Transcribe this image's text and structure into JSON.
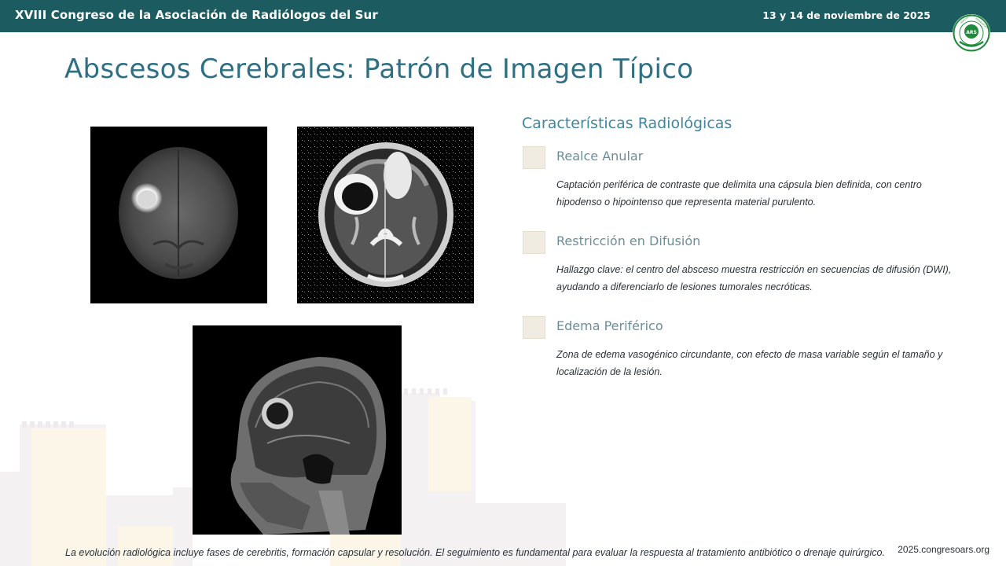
{
  "header": {
    "congress_title": "XVIII Congreso de la Asociación de Radiólogos del Sur",
    "date": "13 y 14 de noviembre de 2025",
    "logo": {
      "center_text": "ARS",
      "ring_left": "ASOCIACIÓN",
      "ring_right": "RADIÓLOGOS",
      "ring_bottom": "SUR"
    }
  },
  "slide": {
    "title": "Abscesos Cerebrales: Patrón de Imagen Típico"
  },
  "images": [
    {
      "name": "mri-axial-dwi",
      "icon": "brain-scan-image"
    },
    {
      "name": "mri-axial-adc",
      "icon": "brain-scan-image"
    },
    {
      "name": "mri-sagittal-t1",
      "icon": "brain-scan-image"
    }
  ],
  "features": {
    "section_title": "Características Radiológicas",
    "items": [
      {
        "title": "Realce Anular",
        "description": "Captación periférica de contraste que delimita una cápsula bien definida, con centro hipodenso o hipointenso que representa material purulento."
      },
      {
        "title": "Restricción en Difusión",
        "description": "Hallazgo clave: el centro del absceso muestra restricción en secuencias de difusión (DWI), ayudando a diferenciarlo de lesiones tumorales necróticas."
      },
      {
        "title": "Edema Periférico",
        "description": "Zona de edema vasogénico circundante, con efecto de masa variable según el tamaño y localización de la lesión."
      }
    ]
  },
  "footer": {
    "note": "La evolución radiológica incluye fases de cerebritis, formación capsular y resolución. El seguimiento es fundamental para evaluar la respuesta al tratamiento antibiótico o drenaje quirúrgico.",
    "url": "2025.congresoars.org"
  },
  "colors": {
    "header_bg": "#1c5b5f",
    "title": "#2f6f84",
    "section_title": "#3f86a0",
    "feature_square": "#f1ece1",
    "logo_green": "#1f8a3c"
  }
}
